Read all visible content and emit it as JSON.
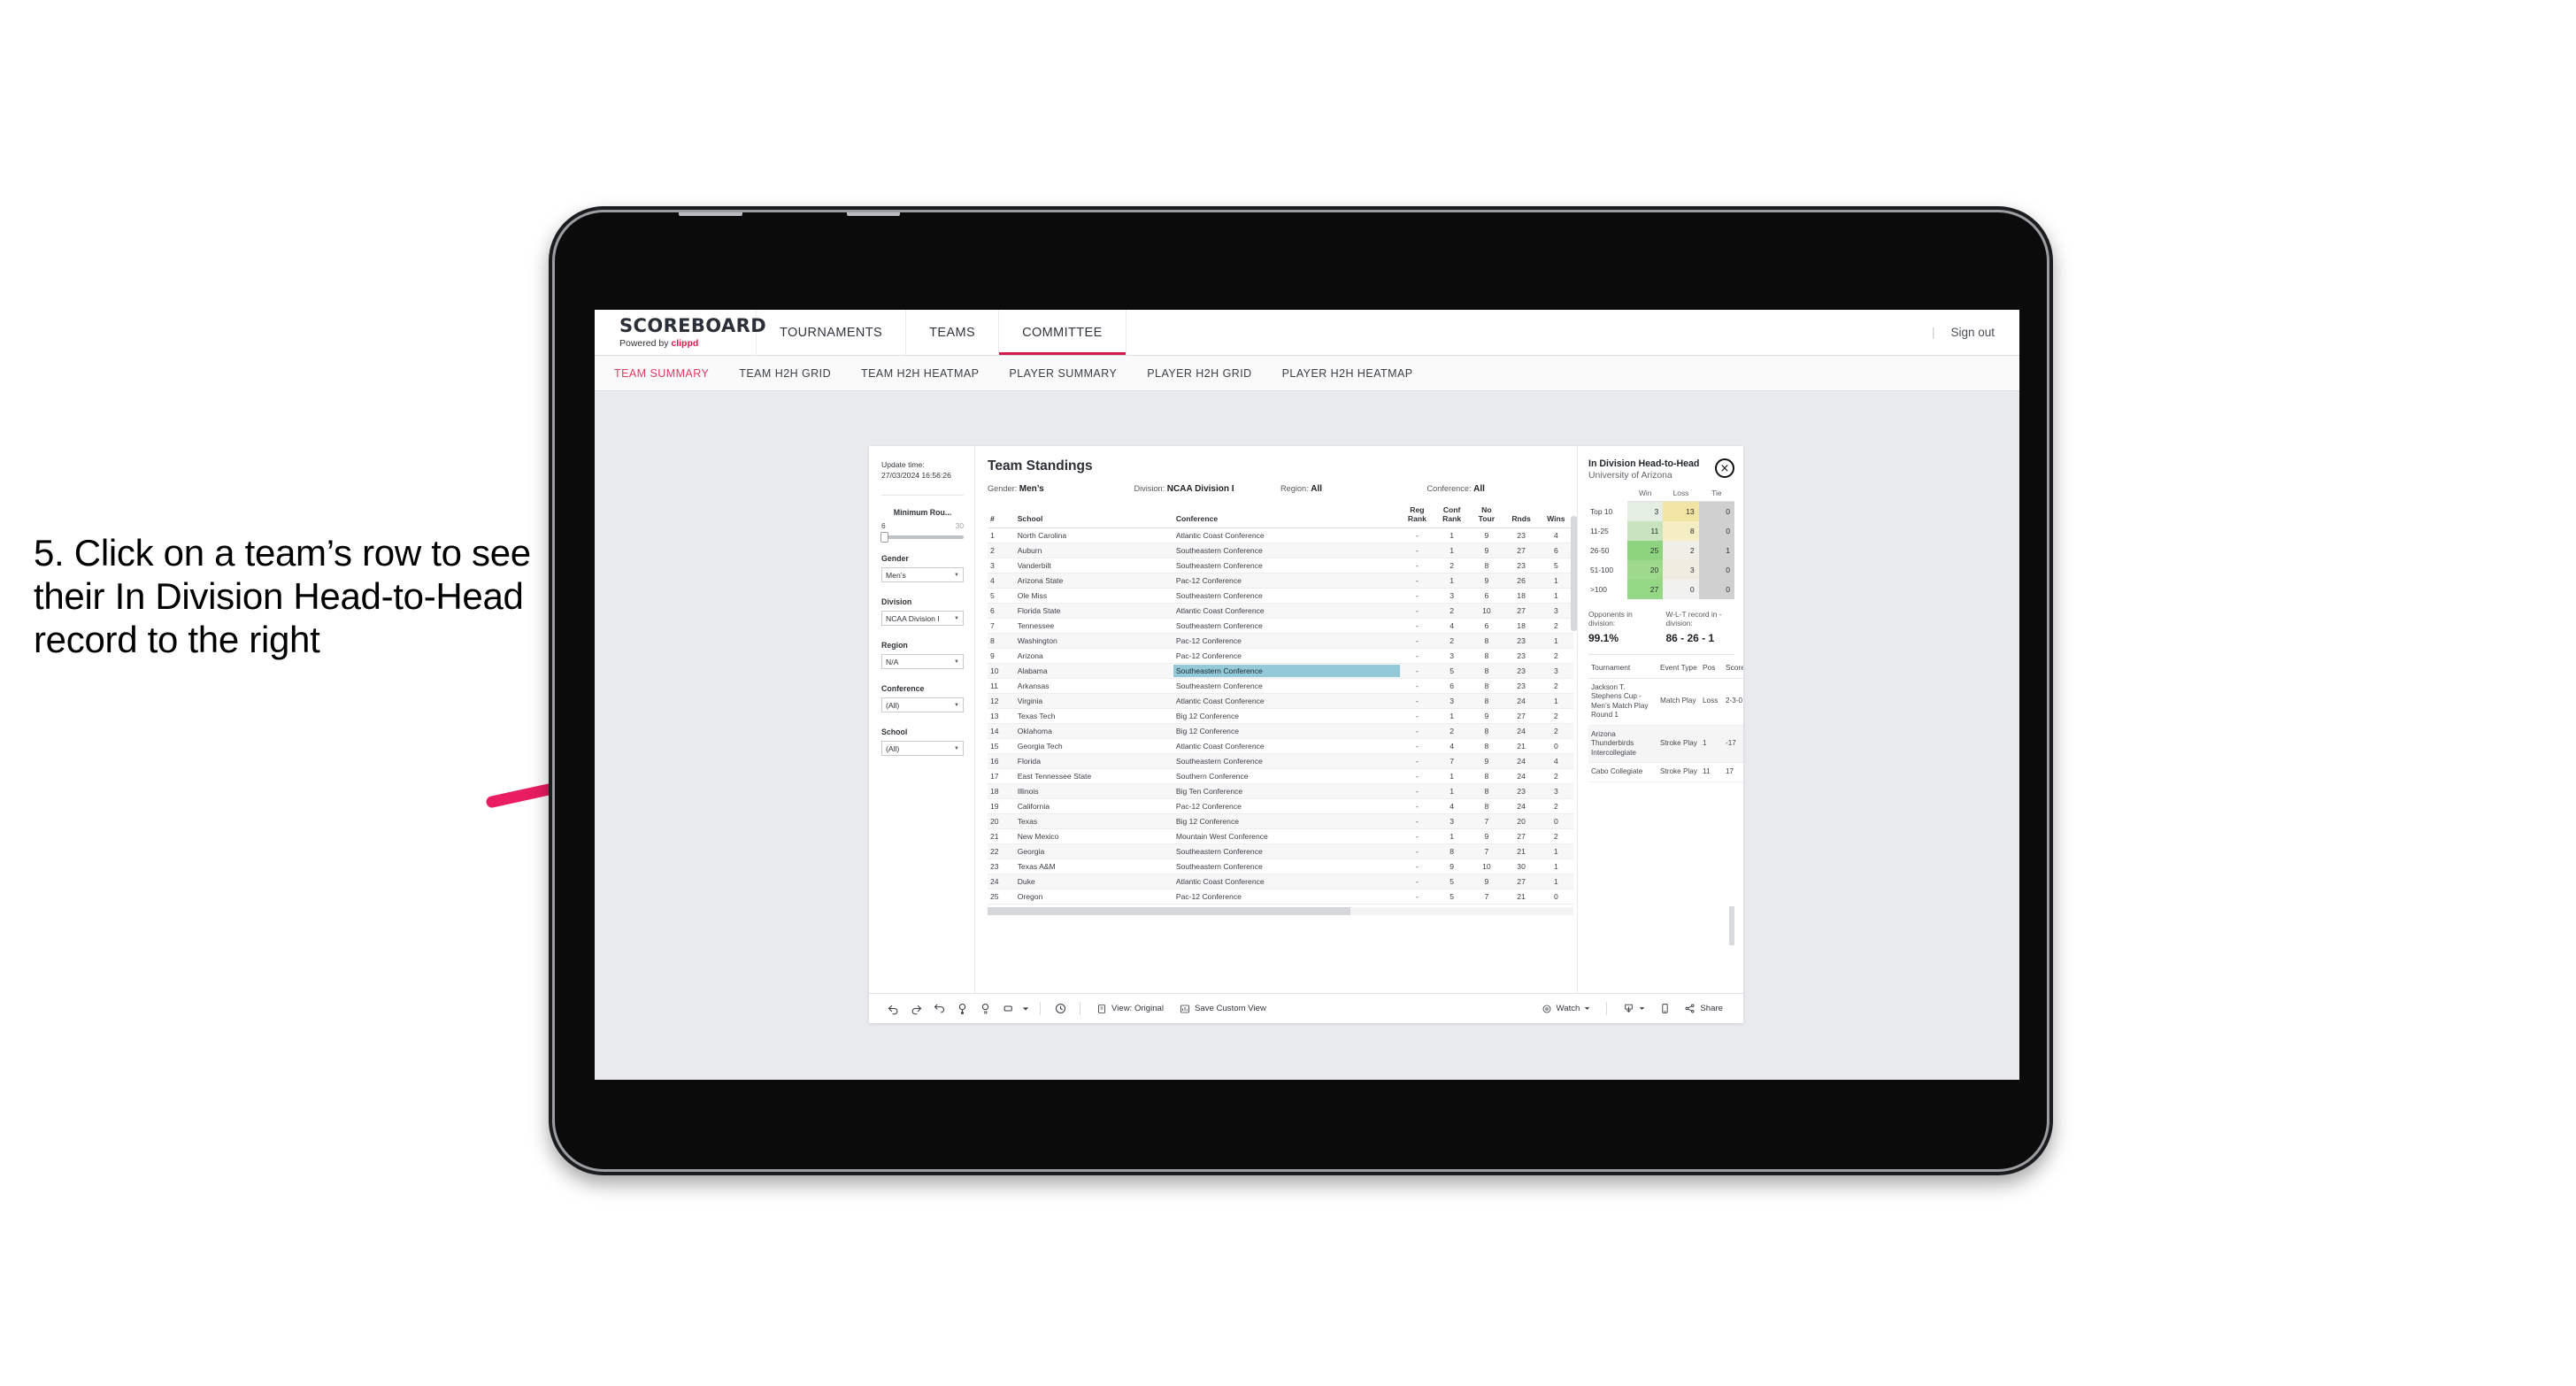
{
  "annotation": {
    "text": "5. Click on a team’s row to see their In Division Head-to-Head record to the right",
    "arrow_color": "#ea1d62"
  },
  "app": {
    "brand": {
      "title": "SCOREBOARD",
      "powered_prefix": "Powered by ",
      "powered_name": "clippd"
    },
    "top_nav": [
      {
        "label": "TOURNAMENTS",
        "active": false
      },
      {
        "label": "TEAMS",
        "active": false
      },
      {
        "label": "COMMITTEE",
        "active": true
      }
    ],
    "top_right": {
      "divider": "|",
      "sign_out": "Sign out"
    },
    "sub_nav": [
      {
        "label": "TEAM SUMMARY",
        "active": true
      },
      {
        "label": "TEAM H2H GRID",
        "active": false
      },
      {
        "label": "TEAM H2H HEATMAP",
        "active": false
      },
      {
        "label": "PLAYER SUMMARY",
        "active": false
      },
      {
        "label": "PLAYER H2H GRID",
        "active": false
      },
      {
        "label": "PLAYER H2H HEATMAP",
        "active": false
      }
    ]
  },
  "filters": {
    "update_time_label": "Update time:",
    "update_time_value": "27/03/2024 16:56:26",
    "min_rounds": {
      "label": "Minimum Rou...",
      "min": "6",
      "max": "30"
    },
    "groups": [
      {
        "label": "Gender",
        "value": "Men’s"
      },
      {
        "label": "Division",
        "value": "NCAA Division I"
      },
      {
        "label": "Region",
        "value": "N/A"
      },
      {
        "label": "Conference",
        "value": "(All)"
      },
      {
        "label": "School",
        "value": "(All)"
      }
    ]
  },
  "standings": {
    "title": "Team Standings",
    "breadcrumbs": [
      {
        "label": "Gender:",
        "value": "Men’s"
      },
      {
        "label": "Division:",
        "value": "NCAA Division I"
      },
      {
        "label": "Region:",
        "value": "All"
      },
      {
        "label": "Conference:",
        "value": "All"
      }
    ],
    "columns": [
      "#",
      "School",
      "Conference",
      "Reg Rank",
      "Conf Rank",
      "No Tour",
      "Rnds",
      "Wins"
    ],
    "selected_row_index": 9,
    "rows": [
      {
        "n": "1",
        "school": "North Carolina",
        "conference": "Atlantic Coast Conference",
        "reg_rank": "-",
        "conf_rank": "1",
        "no_tour": "9",
        "rnds": "23",
        "wins": "4"
      },
      {
        "n": "2",
        "school": "Auburn",
        "conference": "Southeastern Conference",
        "reg_rank": "-",
        "conf_rank": "1",
        "no_tour": "9",
        "rnds": "27",
        "wins": "6"
      },
      {
        "n": "3",
        "school": "Vanderbilt",
        "conference": "Southeastern Conference",
        "reg_rank": "-",
        "conf_rank": "2",
        "no_tour": "8",
        "rnds": "23",
        "wins": "5"
      },
      {
        "n": "4",
        "school": "Arizona State",
        "conference": "Pac-12 Conference",
        "reg_rank": "-",
        "conf_rank": "1",
        "no_tour": "9",
        "rnds": "26",
        "wins": "1"
      },
      {
        "n": "5",
        "school": "Ole Miss",
        "conference": "Southeastern Conference",
        "reg_rank": "-",
        "conf_rank": "3",
        "no_tour": "6",
        "rnds": "18",
        "wins": "1"
      },
      {
        "n": "6",
        "school": "Florida State",
        "conference": "Atlantic Coast Conference",
        "reg_rank": "-",
        "conf_rank": "2",
        "no_tour": "10",
        "rnds": "27",
        "wins": "3"
      },
      {
        "n": "7",
        "school": "Tennessee",
        "conference": "Southeastern Conference",
        "reg_rank": "-",
        "conf_rank": "4",
        "no_tour": "6",
        "rnds": "18",
        "wins": "2"
      },
      {
        "n": "8",
        "school": "Washington",
        "conference": "Pac-12 Conference",
        "reg_rank": "-",
        "conf_rank": "2",
        "no_tour": "8",
        "rnds": "23",
        "wins": "1"
      },
      {
        "n": "9",
        "school": "Arizona",
        "conference": "Pac-12 Conference",
        "reg_rank": "-",
        "conf_rank": "3",
        "no_tour": "8",
        "rnds": "23",
        "wins": "2"
      },
      {
        "n": "10",
        "school": "Alabama",
        "conference": "Southeastern Conference",
        "reg_rank": "-",
        "conf_rank": "5",
        "no_tour": "8",
        "rnds": "23",
        "wins": "3"
      },
      {
        "n": "11",
        "school": "Arkansas",
        "conference": "Southeastern Conference",
        "reg_rank": "-",
        "conf_rank": "6",
        "no_tour": "8",
        "rnds": "23",
        "wins": "2"
      },
      {
        "n": "12",
        "school": "Virginia",
        "conference": "Atlantic Coast Conference",
        "reg_rank": "-",
        "conf_rank": "3",
        "no_tour": "8",
        "rnds": "24",
        "wins": "1"
      },
      {
        "n": "13",
        "school": "Texas Tech",
        "conference": "Big 12 Conference",
        "reg_rank": "-",
        "conf_rank": "1",
        "no_tour": "9",
        "rnds": "27",
        "wins": "2"
      },
      {
        "n": "14",
        "school": "Oklahoma",
        "conference": "Big 12 Conference",
        "reg_rank": "-",
        "conf_rank": "2",
        "no_tour": "8",
        "rnds": "24",
        "wins": "2"
      },
      {
        "n": "15",
        "school": "Georgia Tech",
        "conference": "Atlantic Coast Conference",
        "reg_rank": "-",
        "conf_rank": "4",
        "no_tour": "8",
        "rnds": "21",
        "wins": "0"
      },
      {
        "n": "16",
        "school": "Florida",
        "conference": "Southeastern Conference",
        "reg_rank": "-",
        "conf_rank": "7",
        "no_tour": "9",
        "rnds": "24",
        "wins": "4"
      },
      {
        "n": "17",
        "school": "East Tennessee State",
        "conference": "Southern Conference",
        "reg_rank": "-",
        "conf_rank": "1",
        "no_tour": "8",
        "rnds": "24",
        "wins": "2"
      },
      {
        "n": "18",
        "school": "Illinois",
        "conference": "Big Ten Conference",
        "reg_rank": "-",
        "conf_rank": "1",
        "no_tour": "8",
        "rnds": "23",
        "wins": "3"
      },
      {
        "n": "19",
        "school": "California",
        "conference": "Pac-12 Conference",
        "reg_rank": "-",
        "conf_rank": "4",
        "no_tour": "8",
        "rnds": "24",
        "wins": "2"
      },
      {
        "n": "20",
        "school": "Texas",
        "conference": "Big 12 Conference",
        "reg_rank": "-",
        "conf_rank": "3",
        "no_tour": "7",
        "rnds": "20",
        "wins": "0"
      },
      {
        "n": "21",
        "school": "New Mexico",
        "conference": "Mountain West Conference",
        "reg_rank": "-",
        "conf_rank": "1",
        "no_tour": "9",
        "rnds": "27",
        "wins": "2"
      },
      {
        "n": "22",
        "school": "Georgia",
        "conference": "Southeastern Conference",
        "reg_rank": "-",
        "conf_rank": "8",
        "no_tour": "7",
        "rnds": "21",
        "wins": "1"
      },
      {
        "n": "23",
        "school": "Texas A&M",
        "conference": "Southeastern Conference",
        "reg_rank": "-",
        "conf_rank": "9",
        "no_tour": "10",
        "rnds": "30",
        "wins": "1"
      },
      {
        "n": "24",
        "school": "Duke",
        "conference": "Atlantic Coast Conference",
        "reg_rank": "-",
        "conf_rank": "5",
        "no_tour": "9",
        "rnds": "27",
        "wins": "1"
      },
      {
        "n": "25",
        "school": "Oregon",
        "conference": "Pac-12 Conference",
        "reg_rank": "-",
        "conf_rank": "5",
        "no_tour": "7",
        "rnds": "21",
        "wins": "0"
      }
    ]
  },
  "h2h": {
    "title": "In Division Head-to-Head",
    "subtitle": "University of Arizona",
    "close_icon": "×",
    "columns": [
      "",
      "Win",
      "Loss",
      "Tie"
    ],
    "rows": [
      {
        "bucket": "Top 10",
        "win": "3",
        "loss": "13",
        "tie": "0",
        "win_color": "#e4eee2",
        "loss_color": "#f2e5a4",
        "tie_color": "#d0d0d0"
      },
      {
        "bucket": "11-25",
        "win": "11",
        "loss": "8",
        "tie": "0",
        "win_color": "#c8e3bd",
        "loss_color": "#f5edc3",
        "tie_color": "#d0d0d0"
      },
      {
        "bucket": "26-50",
        "win": "25",
        "loss": "2",
        "tie": "1",
        "win_color": "#8ed47f",
        "loss_color": "#efefe8",
        "tie_color": "#d0d0d0"
      },
      {
        "bucket": "51-100",
        "win": "20",
        "loss": "3",
        "tie": "0",
        "win_color": "#9ed98c",
        "loss_color": "#f0ece0",
        "tie_color": "#d0d0d0"
      },
      {
        "bucket": ">100",
        "win": "27",
        "loss": "0",
        "tie": "0",
        "win_color": "#94d785",
        "loss_color": "#f1f1ef",
        "tie_color": "#d0d0d0"
      }
    ],
    "stats": [
      {
        "label": "Opponents in division:",
        "value": "99.1%"
      },
      {
        "label": "W-L-T record in -division:",
        "value": "86 - 26 - 1"
      }
    ],
    "tournaments": {
      "columns": [
        "Tournament",
        "Event Type",
        "Pos",
        "Score"
      ],
      "rows": [
        {
          "tournament": "Jackson T. Stephens Cup - Men’s Match Play Round 1",
          "event_type": "Match Play",
          "pos": "Loss",
          "score": "2-3-0"
        },
        {
          "tournament": "Arizona Thunderbirds Intercollegiate",
          "event_type": "Stroke Play",
          "pos": "1",
          "score": "-17"
        },
        {
          "tournament": "Cabo Collegiate",
          "event_type": "Stroke Play",
          "pos": "11",
          "score": "17"
        }
      ]
    }
  },
  "toolbar": {
    "icons": [
      "undo-icon",
      "redo-icon",
      "revert-icon",
      "refresh-icon",
      "pause-icon",
      "rectangle-select-icon",
      "chevron-down-icon",
      "clock-icon"
    ],
    "view_original": "View: Original",
    "save_custom_view": "Save Custom View",
    "watch": "Watch",
    "share": "Share"
  }
}
